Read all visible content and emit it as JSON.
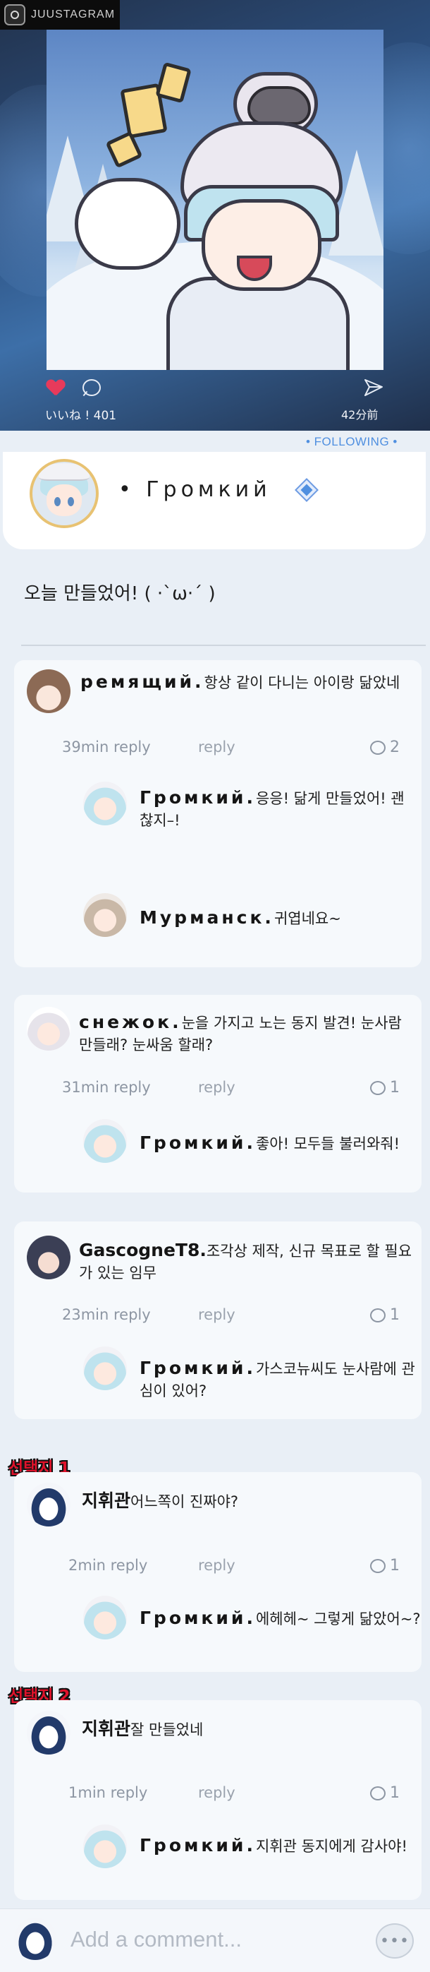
{
  "app": {
    "brand": "JUUSTAGRAM"
  },
  "post": {
    "likes": "いいね ! 401",
    "time_ago": "42分前",
    "following": "• FOLLOWING •",
    "author": "• Громкий",
    "caption": "오늘 만들었어! ( ·`ω·´ )",
    "like_color": "#e73a5b",
    "accent": "#4f8fe0"
  },
  "comments": [
    {
      "author": "ремящий.",
      "text": "항상 같이 다니는 아이랑 닮았네",
      "time": "39min reply",
      "reply_label": "reply",
      "reply_count": "2",
      "replies": [
        {
          "author": "Громкий.",
          "text": "응응! 닮게 만들었어! 괜찮지–!"
        },
        {
          "author": "Мурманск.",
          "text": "귀엽네요~"
        }
      ]
    },
    {
      "author": "снежок.",
      "text": "눈을 가지고 노는 동지 발견! 눈사람 만들래? 눈싸움 할래?",
      "time": "31min reply",
      "reply_label": "reply",
      "reply_count": "1",
      "replies": [
        {
          "author": "Громкий.",
          "text": "좋아! 모두들 불러와줘!"
        }
      ]
    },
    {
      "author": "GascogneT8.",
      "text": "조각상 제작, 신규 목표로 할 필요가 있는 임무",
      "time": "23min reply",
      "reply_label": "reply",
      "reply_count": "1",
      "replies": [
        {
          "author": "Громкий.",
          "text": "가스코뉴씨도 눈사람에 관심이 있어?"
        }
      ]
    },
    {
      "choice": "선택지 1",
      "author": "지휘관",
      "text": "어느쪽이 진짜야?",
      "time": "2min reply",
      "reply_label": "reply",
      "reply_count": "1",
      "replies": [
        {
          "author": "Громкий.",
          "text": "에헤헤~ 그렇게 닮았어~?"
        }
      ]
    },
    {
      "choice": "선택지 2",
      "author": "지휘관",
      "text": "잘 만들었네",
      "time": "1min reply",
      "reply_label": "reply",
      "reply_count": "1",
      "replies": [
        {
          "author": "Громкий.",
          "text": "지휘관 동지에게 감사야!"
        }
      ]
    }
  ],
  "footer": {
    "placeholder": "Add a comment...",
    "chat_icon": "chat-bubble-icon"
  }
}
